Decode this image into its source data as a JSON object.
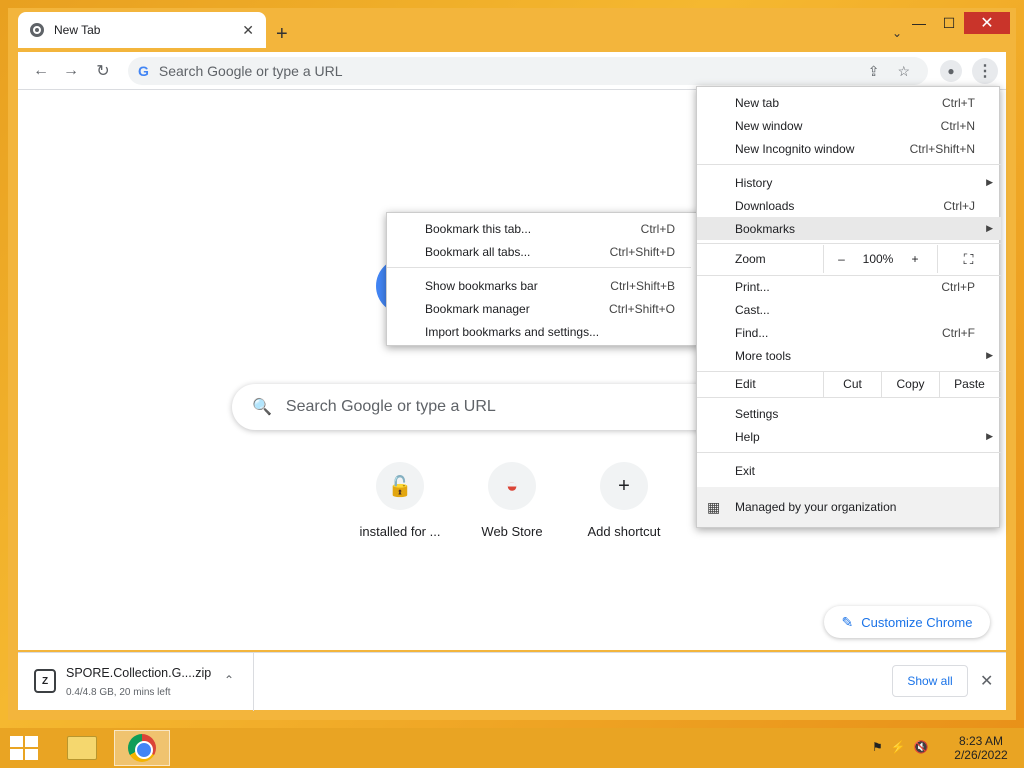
{
  "window": {
    "minimize": "—",
    "maximize": "☐",
    "close": "✕"
  },
  "tab": {
    "title": "New Tab",
    "close": "✕",
    "new_tab": "+",
    "tab_search": "⌄"
  },
  "toolbar": {
    "back": "←",
    "forward": "→",
    "reload": "↻",
    "omnibox_g": "G",
    "omnibox_placeholder": "Search Google or type a URL",
    "share": "⇪",
    "star": "☆",
    "profile": "●",
    "menu": "⋮"
  },
  "ntp": {
    "search_placeholder": "Search Google or type a URL",
    "search_icon": "🔍",
    "shortcuts": [
      {
        "label": "installed for ...",
        "icon": "🔓"
      },
      {
        "label": "Web Store",
        "icon": "◒"
      },
      {
        "label": "Add shortcut",
        "icon": "+"
      }
    ],
    "customize_icon": "✎",
    "customize_label": "Customize Chrome"
  },
  "menu": {
    "items": [
      {
        "label": "New tab",
        "shortcut": "Ctrl+T"
      },
      {
        "label": "New window",
        "shortcut": "Ctrl+N"
      },
      {
        "label": "New Incognito window",
        "shortcut": "Ctrl+Shift+N"
      },
      {
        "label": "History",
        "arrow": "▶"
      },
      {
        "label": "Downloads",
        "shortcut": "Ctrl+J"
      },
      {
        "label": "Bookmarks",
        "arrow": "▶"
      },
      {
        "label": "Print...",
        "shortcut": "Ctrl+P"
      },
      {
        "label": "Cast..."
      },
      {
        "label": "Find...",
        "shortcut": "Ctrl+F"
      },
      {
        "label": "More tools",
        "arrow": "▶"
      },
      {
        "label": "Settings"
      },
      {
        "label": "Help",
        "arrow": "▶"
      },
      {
        "label": "Exit"
      }
    ],
    "zoom": {
      "label": "Zoom",
      "minus": "–",
      "value": "100%",
      "plus": "+",
      "fullscreen": "⛶"
    },
    "edit": {
      "label": "Edit",
      "cut": "Cut",
      "copy": "Copy",
      "paste": "Paste"
    },
    "managed": {
      "icon": "▦",
      "label": "Managed by your organization"
    }
  },
  "bookmarks_submenu": {
    "items": [
      {
        "label": "Bookmark this tab...",
        "shortcut": "Ctrl+D"
      },
      {
        "label": "Bookmark all tabs...",
        "shortcut": "Ctrl+Shift+D"
      },
      {
        "label": "Show bookmarks bar",
        "shortcut": "Ctrl+Shift+B"
      },
      {
        "label": "Bookmark manager",
        "shortcut": "Ctrl+Shift+O"
      },
      {
        "label": "Import bookmarks and settings..."
      }
    ]
  },
  "downloads": {
    "filename": "SPORE.Collection.G....zip",
    "status": "0.4/4.8 GB, 20 mins left",
    "file_icon": "Z",
    "chevron": "⌃",
    "show_all": "Show all",
    "close": "✕"
  },
  "taskbar": {
    "time": "8:23 AM",
    "date": "2/26/2022",
    "tray_icons": [
      "⚑",
      "⚡",
      "🔇"
    ]
  }
}
